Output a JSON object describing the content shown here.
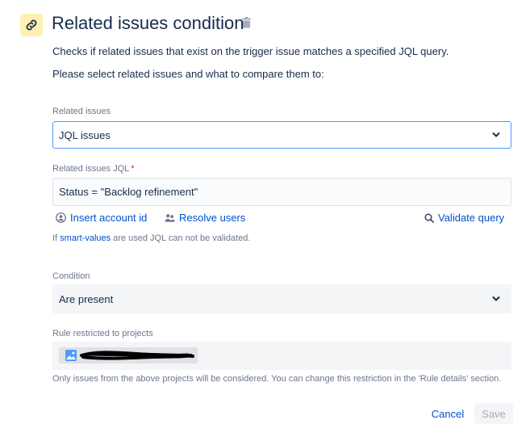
{
  "header": {
    "title": "Related issues condition",
    "icon": "link-icon",
    "trash_icon": "trash-icon"
  },
  "description": {
    "line1": "Checks if related issues that exist on the trigger issue matches a specified JQL query.",
    "line2": "Please select related issues and what to compare them to:"
  },
  "related_issues": {
    "label": "Related issues",
    "value": "JQL issues"
  },
  "jql": {
    "label": "Related issues JQL",
    "required_mark": "*",
    "value": "Status = \"Backlog refinement\""
  },
  "jql_actions": {
    "insert_account": "Insert account id",
    "resolve_users": "Resolve users",
    "validate_query": "Validate query"
  },
  "smart_values_note": {
    "prefix": "If ",
    "link": "smart-values",
    "suffix": " are used JQL can not be validated."
  },
  "condition": {
    "label": "Condition",
    "value": "Are present"
  },
  "restriction": {
    "label": "Rule restricted to projects",
    "note": "Only issues from the above projects will be considered. You can change this restriction in the 'Rule details' section."
  },
  "footer": {
    "cancel_label": "Cancel",
    "save_label": "Save"
  },
  "colors": {
    "accent": "#0052CC",
    "focus_border": "#4C9AFF",
    "icon_bg": "#FFF0B3",
    "required": "#DE350B"
  }
}
